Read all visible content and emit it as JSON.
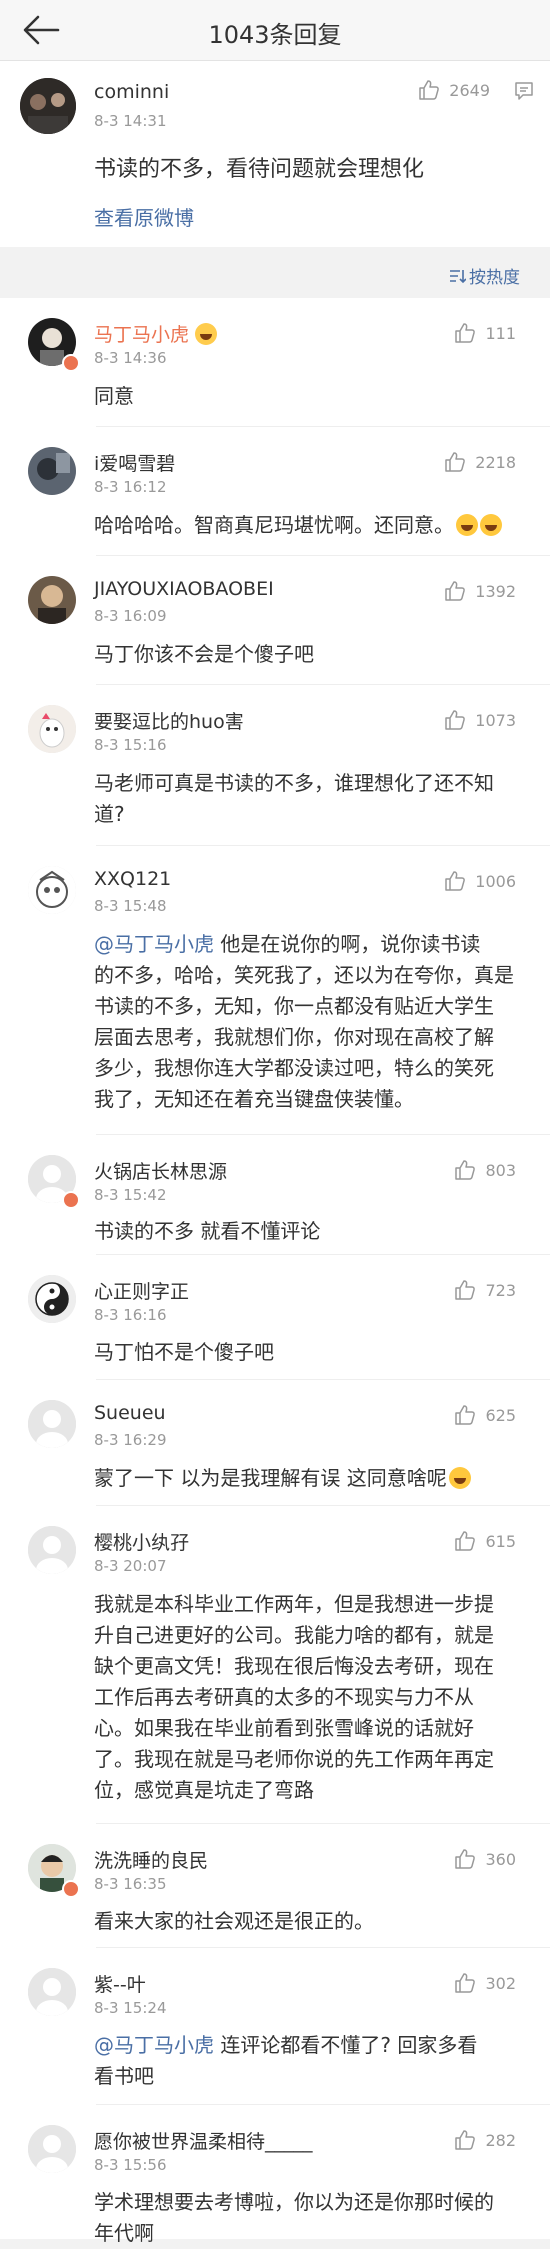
{
  "header": {
    "title": "1043条回复"
  },
  "main_post": {
    "author": "cominni",
    "time": "8-3 14:31",
    "likes": "2649",
    "text": "书读的不多，看待问题就会理想化",
    "view_original": "查看原微博"
  },
  "sort_label": "按热度",
  "replies": [
    {
      "name": "马丁马小虎",
      "time": "8-3 14:36",
      "likes": "111",
      "lines": [
        "同意"
      ]
    },
    {
      "name": "i爱喝雪碧",
      "time": "8-3 16:12",
      "likes": "2218",
      "lines": [
        "哈哈哈哈。智商真尼玛堪忧啊。还同意。"
      ]
    },
    {
      "name": "JIAYOUXIAOBAOBEI",
      "time": "8-3 16:09",
      "likes": "1392",
      "lines": [
        "马丁你该不会是个傻子吧"
      ]
    },
    {
      "name": "要娶逗比的huo害",
      "time": "8-3 15:16",
      "likes": "1073",
      "lines": [
        "马老师可真是书读的不多，谁理想化了还不知",
        "道?"
      ]
    },
    {
      "name": "XXQ121",
      "time": "8-3 15:48",
      "likes": "1006",
      "mention": "@马丁马小虎",
      "lines": [
        " 他是在说你的啊，说你读书读",
        "的不多，哈哈，笑死我了，还以为在夸你，真是",
        "书读的不多，无知，你一点都没有贴近大学生",
        "层面去思考，我就想们你，你对现在高校了解",
        "多少，我想你连大学都没读过吧，特么的笑死",
        "我了，无知还在着充当键盘侠装懂。"
      ]
    },
    {
      "name": "火锅店长林思源",
      "time": "8-3 15:42",
      "likes": "803",
      "lines": [
        "书读的不多 就看不懂评论"
      ]
    },
    {
      "name": "心正则字正",
      "time": "8-3 16:16",
      "likes": "723",
      "lines": [
        "马丁怕不是个傻子吧"
      ]
    },
    {
      "name": "Sueueu",
      "time": "8-3 16:29",
      "likes": "625",
      "lines": [
        "蒙了一下 以为是我理解有误 这同意啥呢"
      ]
    },
    {
      "name": "樱桃小纨孖",
      "time": "8-3 20:07",
      "likes": "615",
      "lines": [
        "我就是本科毕业工作两年，但是我想进一步提",
        "升自己进更好的公司。我能力啥的都有，就是",
        "缺个更高文凭！我现在很后悔没去考研，现在",
        "工作后再去考研真的太多的不现实与力不从",
        "心。如果我在毕业前看到张雪峰说的话就好",
        "了。我现在就是马老师你说的先工作两年再定",
        "位，感觉真是坑走了弯路"
      ]
    },
    {
      "name": "洗洗睡的良民",
      "time": "8-3 16:35",
      "likes": "360",
      "lines": [
        "看来大家的社会观还是很正的。"
      ]
    },
    {
      "name": "紫--叶",
      "time": "8-3 15:24",
      "likes": "302",
      "mention": "@马丁马小虎",
      "lines": [
        " 连评论都看不懂了? 回家多看",
        "看书吧"
      ]
    },
    {
      "name": "愿你被世界温柔相待_____",
      "time": "8-3 15:56",
      "likes": "282",
      "lines": [
        "学术理想要去考博啦，你以为还是你那时候的",
        "年代啊"
      ]
    }
  ],
  "colors": {
    "accent": "#4a6fa5",
    "vip_name": "#eb7350",
    "badge": "#eb7350"
  }
}
